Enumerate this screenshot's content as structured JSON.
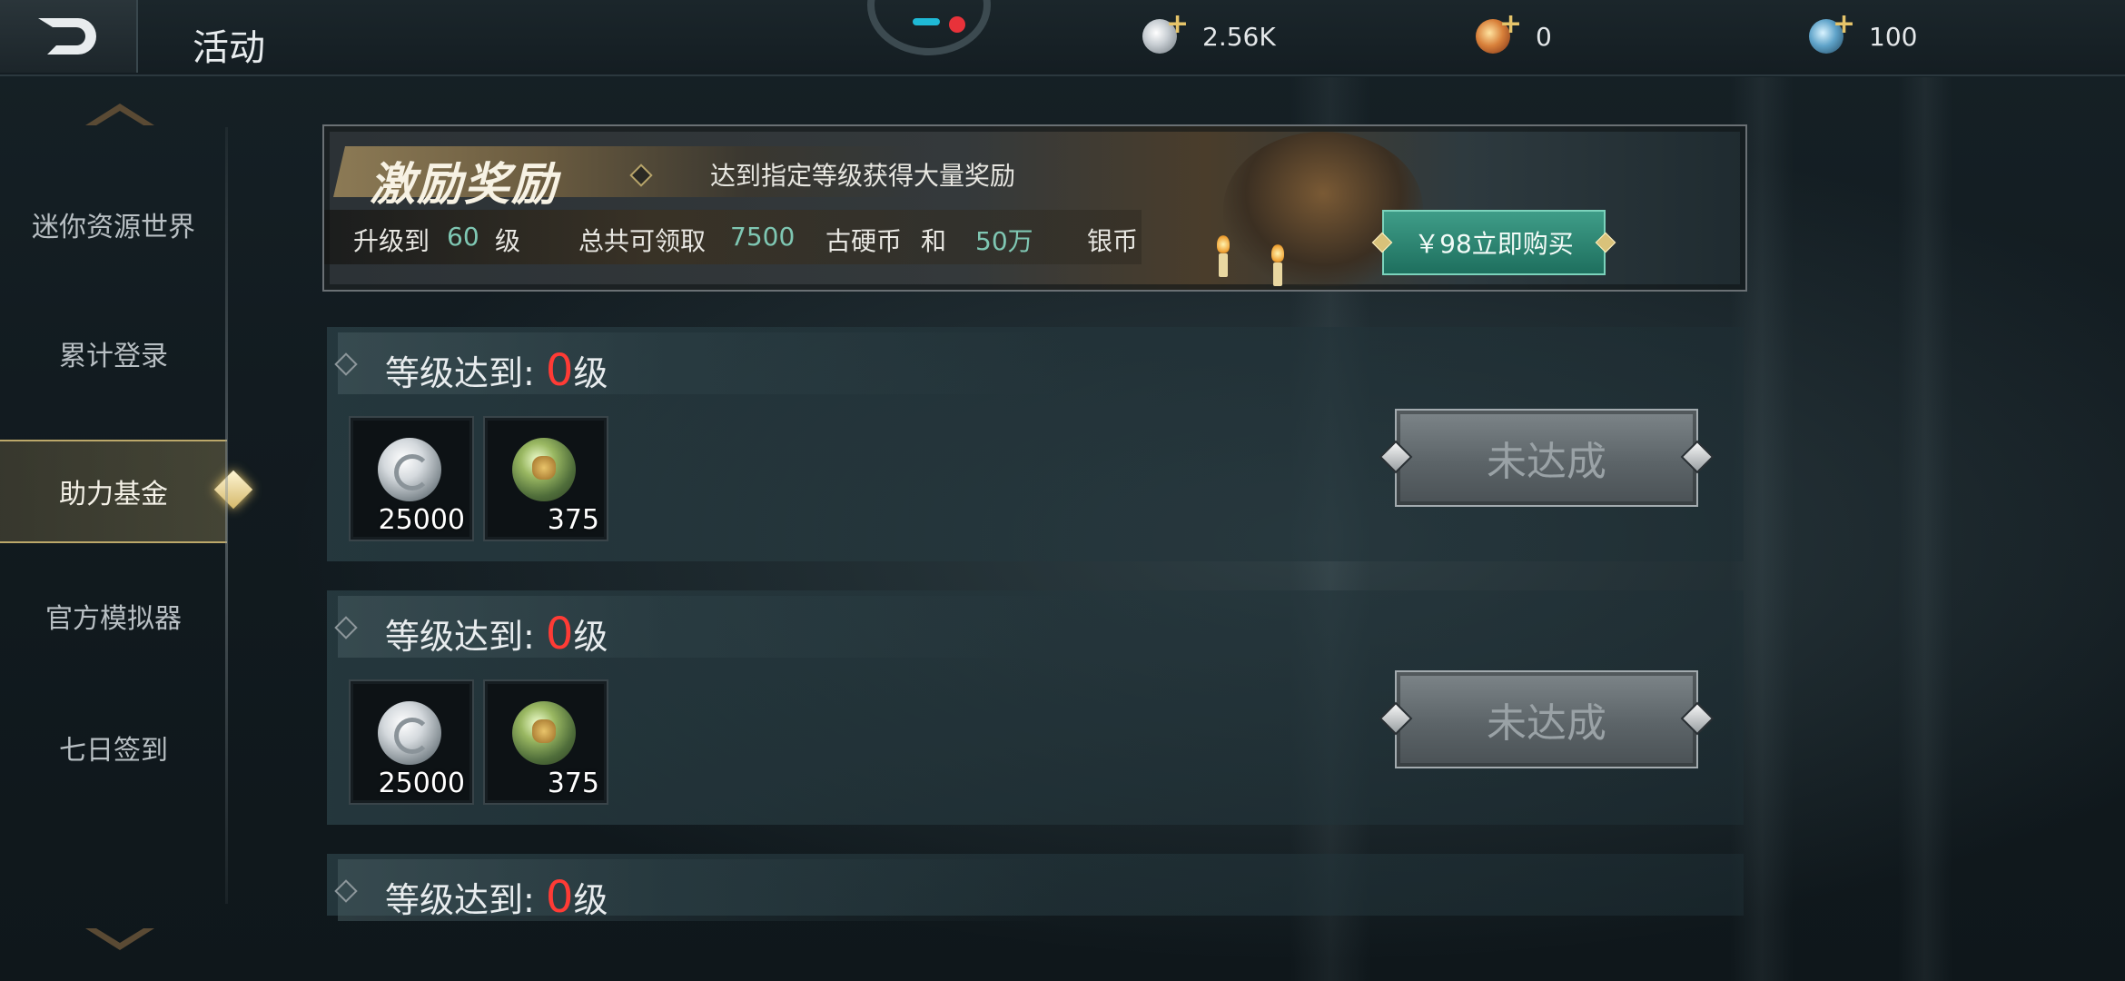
{
  "header": {
    "title": "活动",
    "currencies": [
      {
        "icon": "silver-coin-icon",
        "value": "2.56K"
      },
      {
        "icon": "copper-coin-icon",
        "value": "0"
      },
      {
        "icon": "gem-icon",
        "value": "100"
      }
    ]
  },
  "sidebar": {
    "items": [
      {
        "label": "迷你资源世界",
        "active": false
      },
      {
        "label": "累计登录",
        "active": false
      },
      {
        "label": "助力基金",
        "active": true
      },
      {
        "label": "官方模拟器",
        "active": false
      },
      {
        "label": "七日签到",
        "active": false
      }
    ]
  },
  "banner": {
    "title": "激励奖励",
    "subtitle": "达到指定等级获得大量奖励",
    "row": {
      "p1": "升级到",
      "level": "60",
      "p2": "级",
      "p3": "总共可领取",
      "amount1": "7500",
      "p4": "古硬币",
      "p5": "和",
      "amount2": "50万",
      "p6": "银币"
    },
    "buy_label": "￥98立即购买"
  },
  "rewards": [
    {
      "label": "等级达到:",
      "level": "0",
      "unit": "级",
      "items": [
        {
          "icon": "silver-coin-icon",
          "count": "25000"
        },
        {
          "icon": "jade-coin-icon",
          "count": "375"
        }
      ],
      "status": "未达成"
    },
    {
      "label": "等级达到:",
      "level": "0",
      "unit": "级",
      "items": [
        {
          "icon": "silver-coin-icon",
          "count": "25000"
        },
        {
          "icon": "jade-coin-icon",
          "count": "375"
        }
      ],
      "status": "未达成"
    },
    {
      "label": "等级达到:",
      "level": "0",
      "unit": "级"
    }
  ],
  "colors": {
    "accent_gold": "#bca86a",
    "level_red": "#ff3b35",
    "buy_green": "#2e8a74",
    "number_teal": "#7fc7b3"
  }
}
